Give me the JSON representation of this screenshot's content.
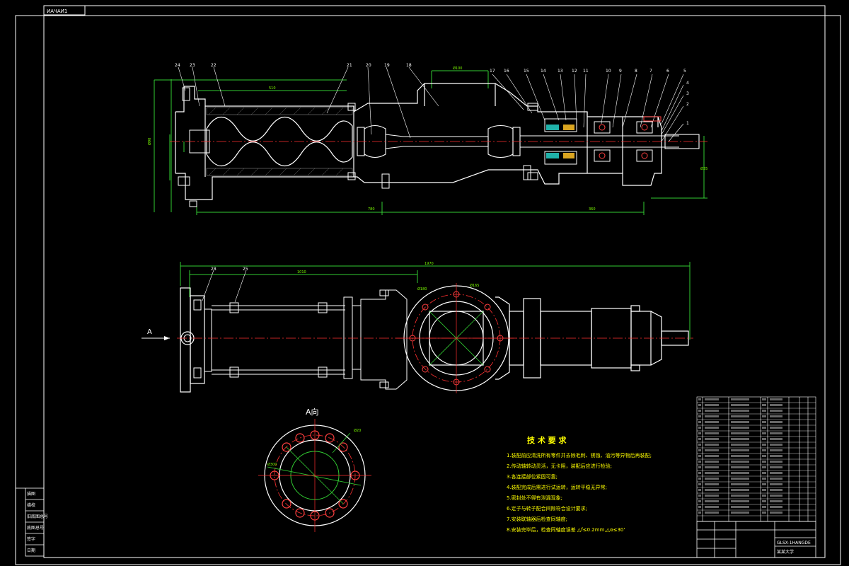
{
  "drawing_code_mirrored": "ИАЧАИ1",
  "view_a_title": "A向",
  "view_arrow_label": "A",
  "tech_requirements": {
    "title": "技 术 要 求",
    "items": [
      "1.装配前应清洗所有零件并去除毛刺、锈蚀、油污等异物后再装配;",
      "2.传动轴转动灵活，无卡阻，装配后应进行检验;",
      "3.各连接部位紧固可靠;",
      "4.装配完成后需进行试运转，运转平稳无异常;",
      "5.密封处不得有泄漏现象;",
      "6.定子与转子配合间隙符合设计要求;",
      "7.安装联轴器后检查同轴度;",
      "8.安装完毕后，检查同轴度误差 △f≤0.2mm,△α≤30'"
    ]
  },
  "title_block": {
    "drawing_number": "GLSX-1HANGDE",
    "school": "某某大学"
  },
  "left_strip_cells": [
    "描图",
    "描校",
    "旧底图总号",
    "底图总号",
    "签字",
    "日期"
  ]
}
